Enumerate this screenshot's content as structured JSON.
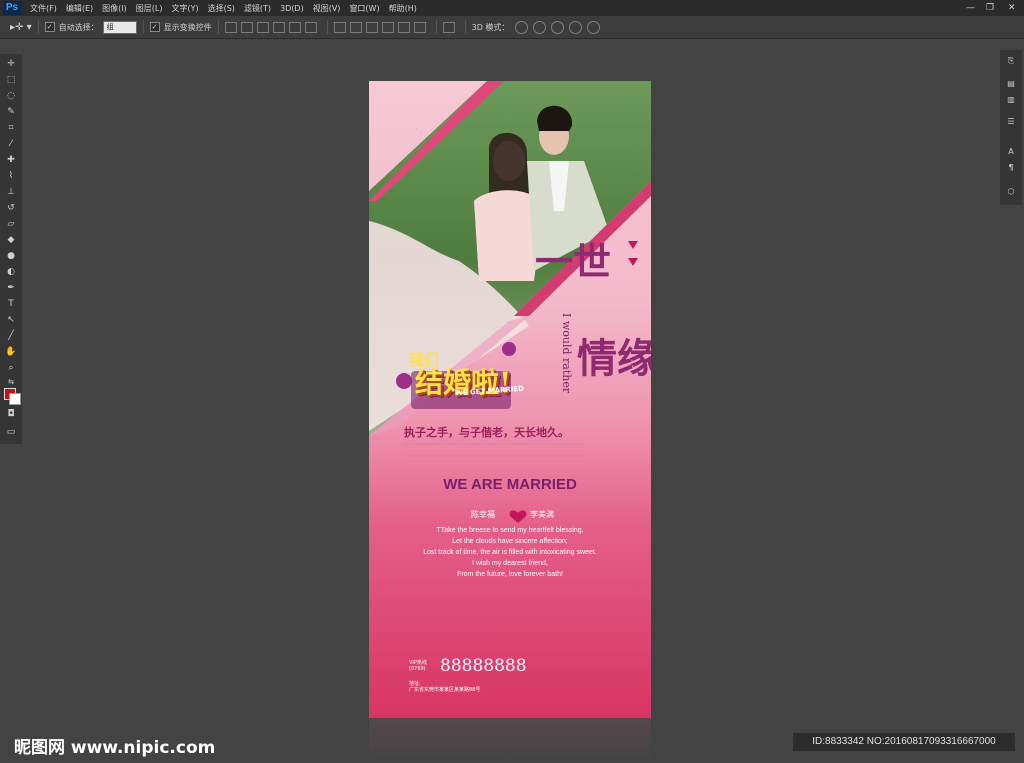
{
  "menubar": {
    "logo": "Ps",
    "items": [
      "文件(F)",
      "编辑(E)",
      "图像(I)",
      "图层(L)",
      "文字(Y)",
      "选择(S)",
      "滤镜(T)",
      "3D(D)",
      "视图(V)",
      "窗口(W)",
      "帮助(H)"
    ],
    "window_controls": [
      "—",
      "❐",
      "✕"
    ]
  },
  "options": {
    "auto_select_label": "自动选择：",
    "auto_select_value": "组",
    "transform_label": "显示变换控件",
    "mode_3d_label": "3D 模式："
  },
  "poster": {
    "headline_small": "我们",
    "headline_big": "结婚啦!",
    "headline_en": "WE GET MARRIED",
    "vertical_title_1": "一世",
    "vertical_title_2": "情缘",
    "vertical_en": "I would rather",
    "tagline_cn": "执子之手，与子偕老，天长地久。",
    "faint_line": "爱你一生一世 牵手到白头 永远在一起 携手共度 幸福美满",
    "married_title": "WE ARE MARRIED",
    "groom": "陈幸福",
    "bride": "李美满",
    "poem": [
      "TTake the breeze to send my heartfelt blessing,",
      "Let the clouds have sincere affection;",
      "Lost track of time, the air is filled with intoxicating sweet.",
      "I wish my dearest friend,",
      "From the future, love forever bath!"
    ],
    "phone_label": "VIP热线",
    "phone_code": "(0769)",
    "phone": "88888888",
    "address_label": "地址:",
    "address": "广东省东莞市某某区某某路88号"
  },
  "footer": {
    "logo": "昵图网 www.nipic.com",
    "id_text": "ID:8833342 NO:20160817093316667000"
  },
  "colors": {
    "accent": "#c0101a",
    "title_purple": "#8e2a6f",
    "headline_yellow": "#ffe14a"
  }
}
